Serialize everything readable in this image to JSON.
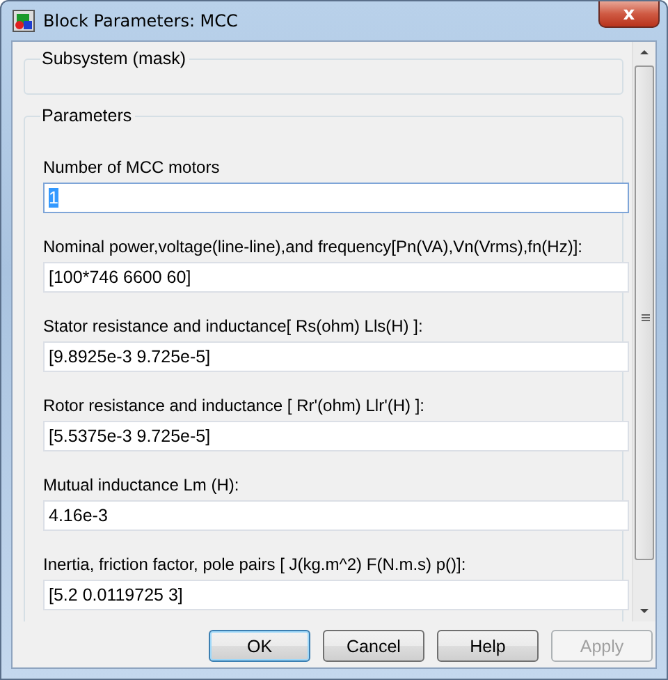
{
  "window": {
    "title": "Block Parameters: MCC",
    "close_label": "x"
  },
  "mask_group": {
    "title": "Subsystem (mask)"
  },
  "parameters_group": {
    "title": "Parameters"
  },
  "parameters": [
    {
      "label": "Number of MCC motors",
      "value": "1",
      "selected": true
    },
    {
      "label": "Nominal power,voltage(line-line),and frequency[Pn(VA),Vn(Vrms),fn(Hz)]:",
      "value": "[100*746 6600 60]",
      "selected": false
    },
    {
      "label": "Stator resistance and inductance[ Rs(ohm)  Lls(H) ]:",
      "value": "[9.8925e-3 9.725e-5]",
      "selected": false
    },
    {
      "label": "Rotor resistance and inductance [ Rr'(ohm)  Llr'(H) ]:",
      "value": "[5.5375e-3 9.725e-5]",
      "selected": false
    },
    {
      "label": "Mutual inductance Lm (H):",
      "value": "4.16e-3",
      "selected": false
    },
    {
      "label": "Inertia, friction factor, pole pairs [ J(kg.m^2)  F(N.m.s)  p()]:",
      "value": "[5.2 0.0119725 3]",
      "selected": false
    }
  ],
  "buttons": [
    {
      "label": "OK",
      "default": true,
      "disabled": false
    },
    {
      "label": "Cancel",
      "default": false,
      "disabled": false
    },
    {
      "label": "Help",
      "default": false,
      "disabled": false
    },
    {
      "label": "Apply",
      "default": false,
      "disabled": true
    }
  ]
}
